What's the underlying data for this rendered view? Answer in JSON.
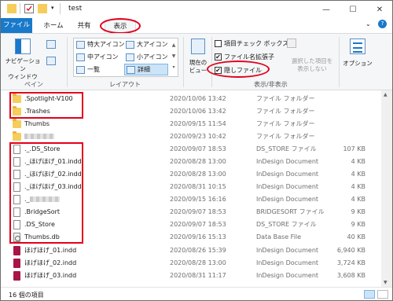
{
  "window": {
    "title": "test",
    "minimize_glyph": "—",
    "maximize_glyph": "☐",
    "close_glyph": "✕"
  },
  "tabs": [
    {
      "label": "ファイル"
    },
    {
      "label": "ホーム"
    },
    {
      "label": "共有"
    },
    {
      "label": "表示"
    }
  ],
  "ribbon": {
    "pane": {
      "nav_label": "ナビゲーション\nウィンドウ",
      "group_label": "ペイン"
    },
    "layout": {
      "group_label": "レイアウト",
      "items": [
        "特大アイコン",
        "大アイコン",
        "中アイコン",
        "小アイコン",
        "一覧",
        "詳細"
      ],
      "selected": "詳細"
    },
    "current_view": {
      "label": "現在の\nビュー"
    },
    "show_hide": {
      "group_label": "表示/非表示",
      "checkboxes": [
        {
          "label": "項目チェック ボックス",
          "checked": false
        },
        {
          "label": "ファイル名拡張子",
          "checked": true
        },
        {
          "label": "隠しファイル",
          "checked": true
        }
      ],
      "hide_selected": "選択した項目を\n表示しない",
      "options": "オプション"
    }
  },
  "files": [
    {
      "name": ".Spotlight-V100",
      "date": "2020/10/06 13:42",
      "type": "ファイル フォルダー",
      "size": "",
      "icon": "folder-icon"
    },
    {
      "name": ".Trashes",
      "date": "2020/10/06 13:42",
      "type": "ファイル フォルダー",
      "size": "",
      "icon": "folder-icon"
    },
    {
      "name": "Thumbs",
      "date": "2020/09/15 11:54",
      "type": "ファイル フォルダー",
      "size": "",
      "icon": "folder-icon"
    },
    {
      "name": "",
      "date": "2020/09/23 10:42",
      "type": "ファイル フォルダー",
      "size": "",
      "icon": "folder-icon",
      "redacted": true
    },
    {
      "name": "._.DS_Store",
      "date": "2020/09/07 18:53",
      "type": "DS_STORE ファイル",
      "size": "107 KB",
      "icon": "document-icon"
    },
    {
      "name": "._ほげほげ_01.indd",
      "date": "2020/08/28 13:00",
      "type": "InDesign Document",
      "size": "4 KB",
      "icon": "document-icon"
    },
    {
      "name": "._ほげほげ_02.indd",
      "date": "2020/08/28 13:00",
      "type": "InDesign Document",
      "size": "4 KB",
      "icon": "document-icon"
    },
    {
      "name": "._ほげほげ_03.indd",
      "date": "2020/08/31 10:15",
      "type": "InDesign Document",
      "size": "4 KB",
      "icon": "document-icon"
    },
    {
      "name": "._",
      "date": "2020/09/15 16:16",
      "type": "InDesign Document",
      "size": "4 KB",
      "icon": "document-icon",
      "redacted": true
    },
    {
      "name": ".BridgeSort",
      "date": "2020/09/07 18:53",
      "type": "BRIDGESORT ファイル",
      "size": "9 KB",
      "icon": "document-icon"
    },
    {
      "name": ".DS_Store",
      "date": "2020/09/07 18:53",
      "type": "DS_STORE ファイル",
      "size": "9 KB",
      "icon": "document-icon"
    },
    {
      "name": "Thumbs.db",
      "date": "2020/09/16 15:13",
      "type": "Data Base File",
      "size": "40 KB",
      "icon": "database-icon"
    },
    {
      "name": "ほげほげ_01.indd",
      "date": "2020/08/26 15:39",
      "type": "InDesign Document",
      "size": "6,940 KB",
      "icon": "indesign-icon"
    },
    {
      "name": "ほげほげ_02.indd",
      "date": "2020/08/28 13:00",
      "type": "InDesign Document",
      "size": "3,724 KB",
      "icon": "indesign-icon"
    },
    {
      "name": "ほげほげ_03.indd",
      "date": "2020/08/31 11:17",
      "type": "InDesign Document",
      "size": "3,608 KB",
      "icon": "indesign-icon"
    }
  ],
  "status": {
    "text": "16 個の項目"
  },
  "colors": {
    "accent": "#1979ca",
    "highlight": "#e3001b",
    "folder": "#f6cd5b",
    "indesign": "#a81645"
  }
}
